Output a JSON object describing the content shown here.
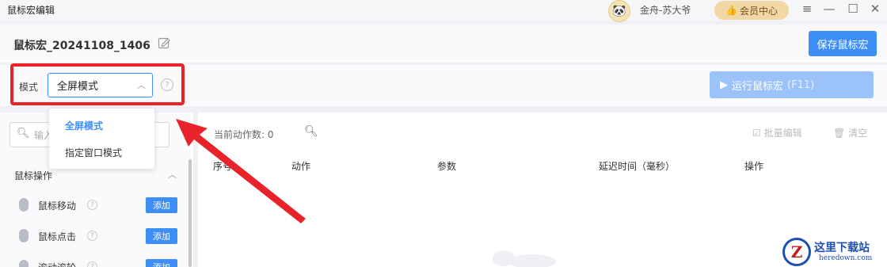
{
  "window": {
    "title": "鼠标宏编辑",
    "user_name": "金舟-苏大爷",
    "vip_label": "会员中心",
    "controls": [
      "≡",
      "—",
      "☐",
      "✕"
    ]
  },
  "header": {
    "macro_name": "鼠标宏_20241108_1406",
    "save_label": "保存鼠标宏"
  },
  "mode": {
    "label": "模式",
    "selected": "全屏模式",
    "options": [
      "全屏模式",
      "指定窗口模式"
    ],
    "help": "?"
  },
  "run": {
    "label": "运行鼠标宏",
    "shortcut": "(F11)"
  },
  "left": {
    "search_placeholder": "输入",
    "section_title": "鼠标操作",
    "actions": [
      {
        "label": "鼠标移动",
        "add": "添加"
      },
      {
        "label": "鼠标点击",
        "add": "添加"
      },
      {
        "label": "滚动滚轮",
        "add": "添加"
      }
    ]
  },
  "right": {
    "count_label": "当前动作数:",
    "count_value": "0",
    "batch_edit": "批量编辑",
    "clear": "清空",
    "columns": [
      "序号",
      "动作",
      "参数",
      "延迟时间（毫秒）",
      "操作"
    ]
  },
  "watermark": {
    "logo_letter": "Z",
    "cn": "这里下载站",
    "en": "heredown.com"
  },
  "colors": {
    "accent": "#3e8ef7",
    "run_disabled": "#9cc3f9",
    "annotation_red": "#e8232a",
    "vip_bg": "#f1d8a6"
  }
}
